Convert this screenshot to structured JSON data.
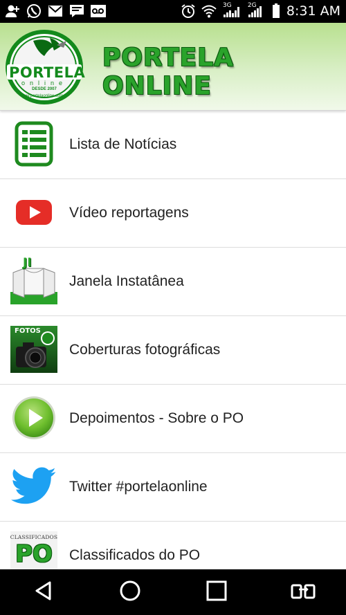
{
  "status_bar": {
    "time": "8:31 AM",
    "signal1_label": "3G",
    "signal2_label": "2G",
    "left_icons": [
      "add-contact-icon",
      "whatsapp-icon",
      "gmail-icon",
      "message-icon",
      "voicemail-icon"
    ],
    "right_icons": [
      "alarm-icon",
      "wifi-icon",
      "signal-icon",
      "signal-icon",
      "battery-icon"
    ]
  },
  "header": {
    "title": "PORTELA ONLINE",
    "logo": {
      "name": "PORTELA",
      "sub": "online",
      "since": "DESDE 2007",
      "url": "www.portelaonline.com.br"
    }
  },
  "menu": {
    "items": [
      {
        "label": "Lista de Notícias",
        "icon": "news-list-icon"
      },
      {
        "label": "Vídeo reportagens",
        "icon": "youtube-icon"
      },
      {
        "label": "Janela Instatânea",
        "icon": "window-icon",
        "icon_text": "JI"
      },
      {
        "label": "Coberturas fotográficas",
        "icon": "camera-icon",
        "icon_text": "FOTOS"
      },
      {
        "label": "Depoimentos - Sobre o PO",
        "icon": "play-icon"
      },
      {
        "label": "Twitter #portelaonline",
        "icon": "twitter-icon"
      },
      {
        "label": "Classificados do PO",
        "icon": "classifieds-icon",
        "icon_text": "CLASSIFICADOS",
        "icon_text2": "PO"
      }
    ]
  },
  "nav_bar": {
    "buttons": [
      "back-icon",
      "home-icon",
      "recents-icon",
      "switch-sim-icon"
    ]
  },
  "colors": {
    "brand_green": "#2aa32b",
    "dark_green": "#0d5a10",
    "youtube_red": "#e52d27",
    "twitter_blue": "#1da1f2"
  }
}
